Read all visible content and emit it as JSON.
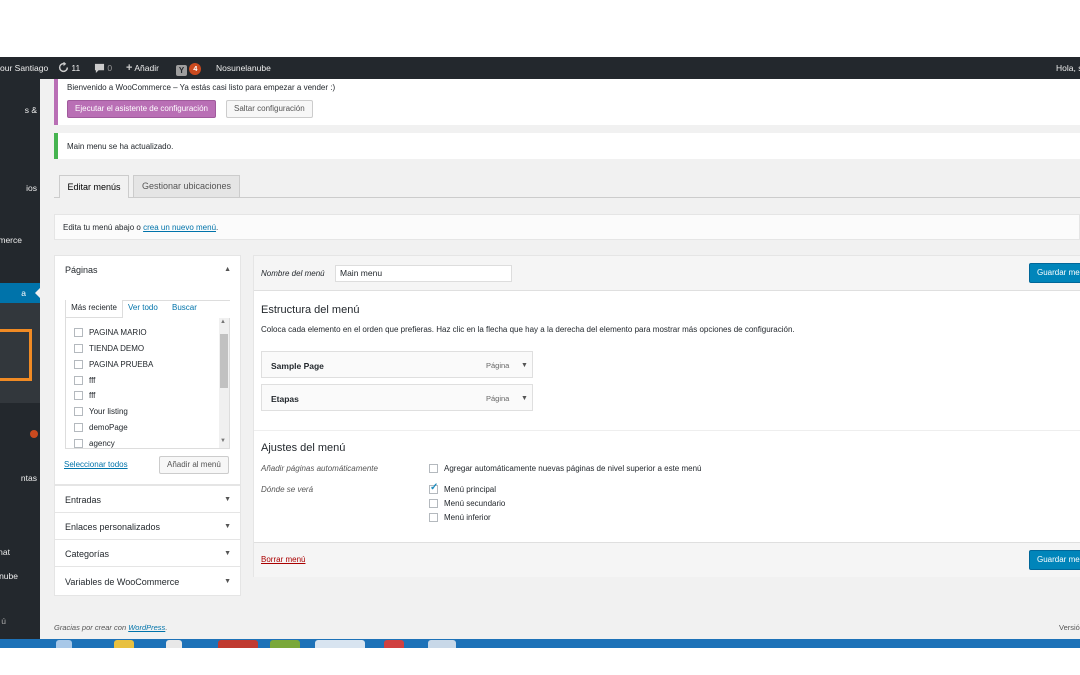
{
  "adminbar": {
    "site": "our Santiago",
    "updates_count": "11",
    "comments_count": "0",
    "new_label": "Añadir",
    "yoast_badge": "4",
    "site2": "Nosunelanube",
    "greeting": "Hola, s"
  },
  "sidebar": {
    "items": [
      "s &",
      "ios",
      "merce",
      "a",
      "ntas",
      "nat",
      "nube",
      "ú"
    ]
  },
  "woo_notice": {
    "text": "Bienvenido a WooCommerce – Ya estás casi listo para empezar a vender :)",
    "wizard_button": "Ejecutar el asistente de configuración",
    "skip_button": "Saltar configuración"
  },
  "updated_notice": "Main menu se ha actualizado.",
  "tabs": {
    "edit": "Editar menús",
    "manage": "Gestionar ubicaciones"
  },
  "edit_line": {
    "before": "Edita tu menú abajo o",
    "link": "crea un nuevo menú",
    "after": "."
  },
  "pages_box": {
    "title": "Páginas",
    "tabs": [
      "Más reciente",
      "Ver todo",
      "Buscar"
    ],
    "items": [
      "PAGINA MARIO",
      "TIENDA DEMO",
      "PAGINA PRUEBA",
      "fff",
      "fff",
      "Your listing",
      "demoPage",
      "agency"
    ],
    "select_all": "Seleccionar todos",
    "add_button": "Añadir al menú"
  },
  "accordion": [
    "Entradas",
    "Enlaces personalizados",
    "Categorías",
    "Variables de WooCommerce"
  ],
  "menu_name": {
    "label": "Nombre del menú",
    "value": "Main menu",
    "save_button": "Guardar me"
  },
  "structure": {
    "title": "Estructura del menú",
    "description": "Coloca cada elemento en el orden que prefieras. Haz clic en la flecha que hay a la derecha del elemento para mostrar más opciones de configuración.",
    "items": [
      {
        "title": "Sample Page",
        "type": "Página"
      },
      {
        "title": "Etapas",
        "type": "Página"
      }
    ]
  },
  "settings": {
    "title": "Ajustes del menú",
    "auto_label": "Añadir páginas automáticamente",
    "auto_option": "Agregar automáticamente nuevas páginas de nivel superior a este menú",
    "where_label": "Dónde se verá",
    "locations": [
      {
        "label": "Menú principal",
        "checked": true
      },
      {
        "label": "Menú secundario",
        "checked": false
      },
      {
        "label": "Menú inferior",
        "checked": false
      }
    ]
  },
  "footer_bar": {
    "delete_link": "Borrar menú",
    "save_button": "Guardar me"
  },
  "footer": {
    "thanks_before": "Gracias por crear con",
    "thanks_link": "WordPress",
    "thanks_after": ".",
    "version": "Versió"
  },
  "colors": {
    "accent": "#0085ba",
    "woo": "#b96fb5",
    "adminbar": "#23282d",
    "highlight": "#f08a24"
  },
  "icons": [
    "updates-icon",
    "comment-icon",
    "plus-icon",
    "yoast-icon",
    "collapse-arrow-icon",
    "chevron-down-icon"
  ]
}
